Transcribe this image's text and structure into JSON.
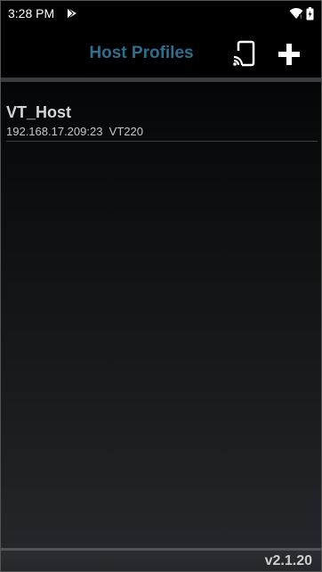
{
  "status_bar": {
    "time": "3:28 PM",
    "icons": [
      "play-store-icon",
      "wifi-icon",
      "battery-icon"
    ]
  },
  "header": {
    "title": "Host Profiles",
    "title_color": "#2e6f8f",
    "actions": [
      "cast-icon",
      "add-icon"
    ]
  },
  "hosts": [
    {
      "name": "VT_Host",
      "address": "192.168.17.209:23",
      "emulation": "VT220"
    }
  ],
  "footer": {
    "version": "v2.1.20"
  }
}
